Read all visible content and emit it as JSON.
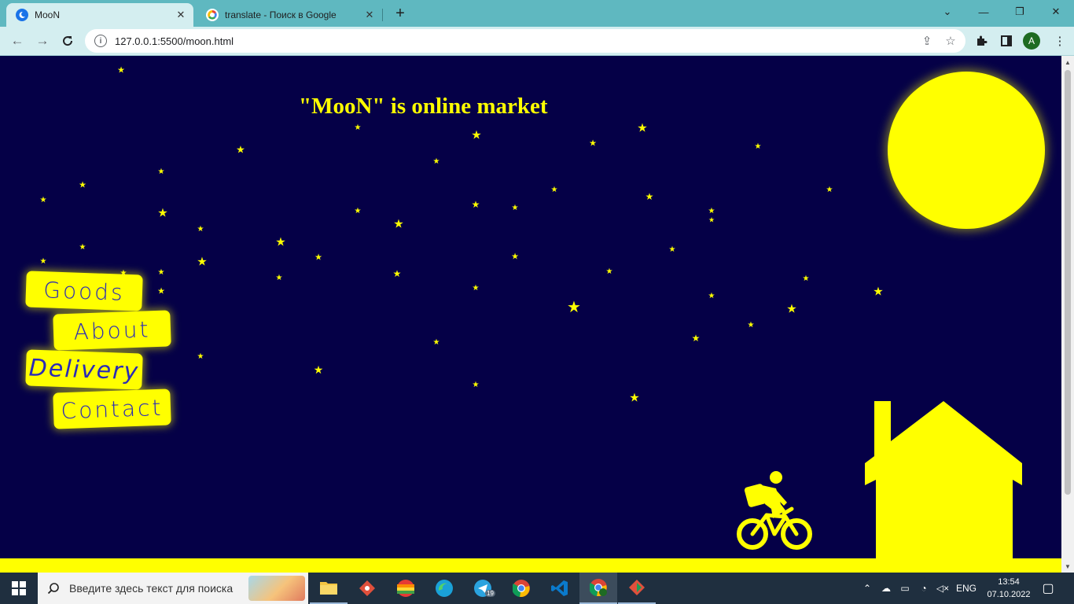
{
  "browser": {
    "tabs": [
      {
        "title": "MooN",
        "active": true,
        "icon": "moon-favicon"
      },
      {
        "title": "translate - Поиск в Google",
        "active": false,
        "icon": "google-favicon"
      }
    ],
    "new_tab": "+",
    "window_controls": {
      "list": "⌄",
      "minimize": "—",
      "restore": "❐",
      "close": "✕"
    },
    "url": "127.0.0.1:5500/moon.html",
    "avatar_letter": "A"
  },
  "page": {
    "headline": "\"MooN\" is online market",
    "menu": {
      "goods": "Goods",
      "about": "About",
      "delivery": "Delivery",
      "contact": "Contact"
    },
    "colors": {
      "sky": "#050047",
      "accent": "#ffff00",
      "button_text": "#2a2ab8"
    }
  },
  "taskbar": {
    "search_placeholder": "Введите здесь текст для поиска",
    "language": "ENG",
    "time": "13:54",
    "date": "07.10.2022",
    "telegram_badge": "19"
  }
}
